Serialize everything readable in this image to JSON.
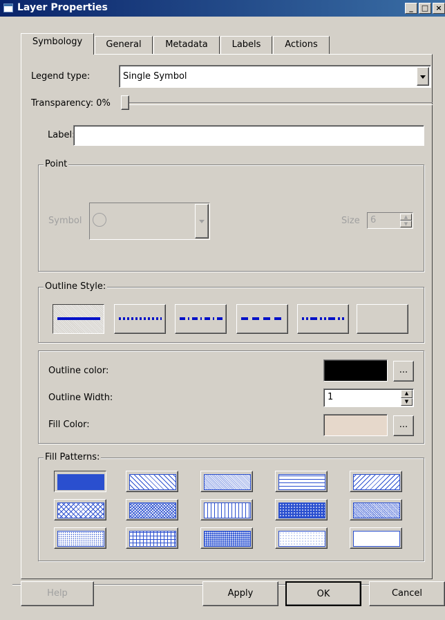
{
  "window": {
    "title": "Layer Properties",
    "controls": [
      "_",
      "□",
      "×"
    ]
  },
  "tabs": [
    {
      "label": "Symbology",
      "active": true
    },
    {
      "label": "General"
    },
    {
      "label": "Metadata"
    },
    {
      "label": "Labels"
    },
    {
      "label": "Actions"
    }
  ],
  "legend": {
    "label": "Legend type:",
    "value": "Single Symbol"
  },
  "transparency": {
    "label": "Transparency: 0%",
    "value_fraction": 0
  },
  "label_field": {
    "label": "Label:",
    "value": ""
  },
  "point_group": {
    "title": "Point",
    "symbol_label": "Symbol",
    "size_label": "Size",
    "size_value": "6"
  },
  "outline_style": {
    "title": "Outline Style:",
    "styles": [
      "solid",
      "dotted",
      "dash-dot",
      "dashed",
      "dot-dash",
      "none"
    ],
    "selected": 0
  },
  "colors": {
    "outline_color_label": "Outline color:",
    "outline_color": "#000000",
    "outline_width_label": "Outline Width:",
    "outline_width": "1",
    "fill_color_label": "Fill Color:",
    "fill_color": "#e6d8cb",
    "more_button": "..."
  },
  "fill_patterns": {
    "title": "Fill Patterns:",
    "patterns": [
      "solid",
      "diagonal-left",
      "dense-dots",
      "horizontal",
      "diagonal-right",
      "diagonal-cross",
      "crosshatch-fine",
      "vertical",
      "dense-dots-dark",
      "checker",
      "sparse-dots",
      "grid",
      "dense-dots-medium",
      "sparse-dots-light",
      "hollow"
    ],
    "selected": 0
  },
  "buttons": {
    "help": "Help",
    "apply": "Apply",
    "ok": "OK",
    "cancel": "Cancel"
  },
  "accent": "#2a4fcf"
}
